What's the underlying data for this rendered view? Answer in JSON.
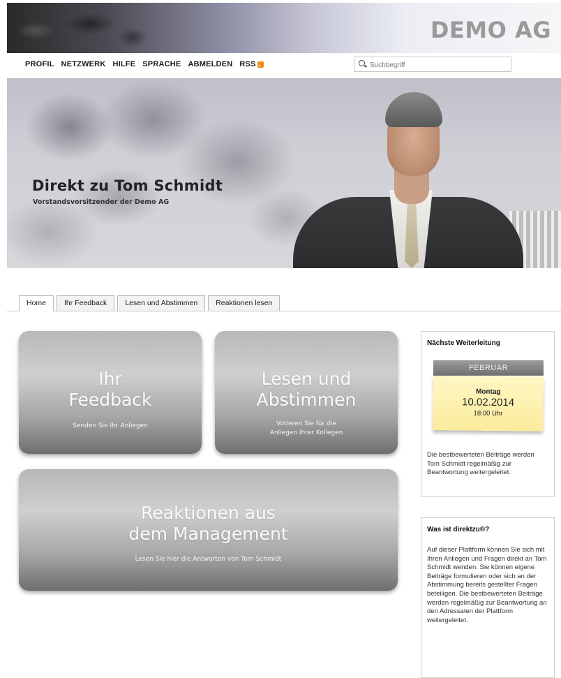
{
  "header": {
    "logo": "DEMO AG"
  },
  "nav": {
    "items": [
      "PROFIL",
      "NETZWERK",
      "HILFE",
      "SPRACHE",
      "ABMELDEN"
    ],
    "rss_label": "RSS",
    "search_placeholder": "Suchbegriff"
  },
  "hero": {
    "title": "Direkt zu Tom Schmidt",
    "subtitle": "Vorstandsvorsitzender der Demo AG"
  },
  "tabs": [
    "Home",
    "Ihr Feedback",
    "Lesen und Abstimmen",
    "Reaktionen lesen"
  ],
  "tiles": [
    {
      "title": "Ihr\nFeedback",
      "subtitle": "Senden Sie Ihr Anliegen"
    },
    {
      "title": "Lesen und\nAbstimmen",
      "subtitle": "Votieren Sie für die\nAnliegen Ihrer Kollegen"
    },
    {
      "title": "Reaktionen aus\ndem Management",
      "subtitle": "Lesen Sie hier die Antworten von Tom Schmidt"
    }
  ],
  "next_forwarding": {
    "title": "Nächste Weiterleitung",
    "month": "FEBRUAR",
    "weekday": "Montag",
    "date": "10.02.2014",
    "time": "18:00 Uhr",
    "text": "Die bestbewerteten Beiträge werden Tom Schmidt regelmäßig zur Beantwortung weitergeleitet."
  },
  "about": {
    "title": "Was ist direktzu®?",
    "text": "Auf dieser Plattform können Sie sich mit Ihren Anliegen und Fragen direkt an Tom Schmidt wenden. Sie können eigene Beiträge formulieren oder sich an der Abstimmung bereits gestellter Fragen beteiligen. Die bestbewerteten Beiträge werden regelmäßig zur Beantwortung an den Adressaten der Plattform weitergeleitet."
  },
  "colors": {
    "tile_gray": "#a6a6a6",
    "calendar_yellow": "#fbeb9c",
    "rss_orange": "#f08a1a"
  }
}
